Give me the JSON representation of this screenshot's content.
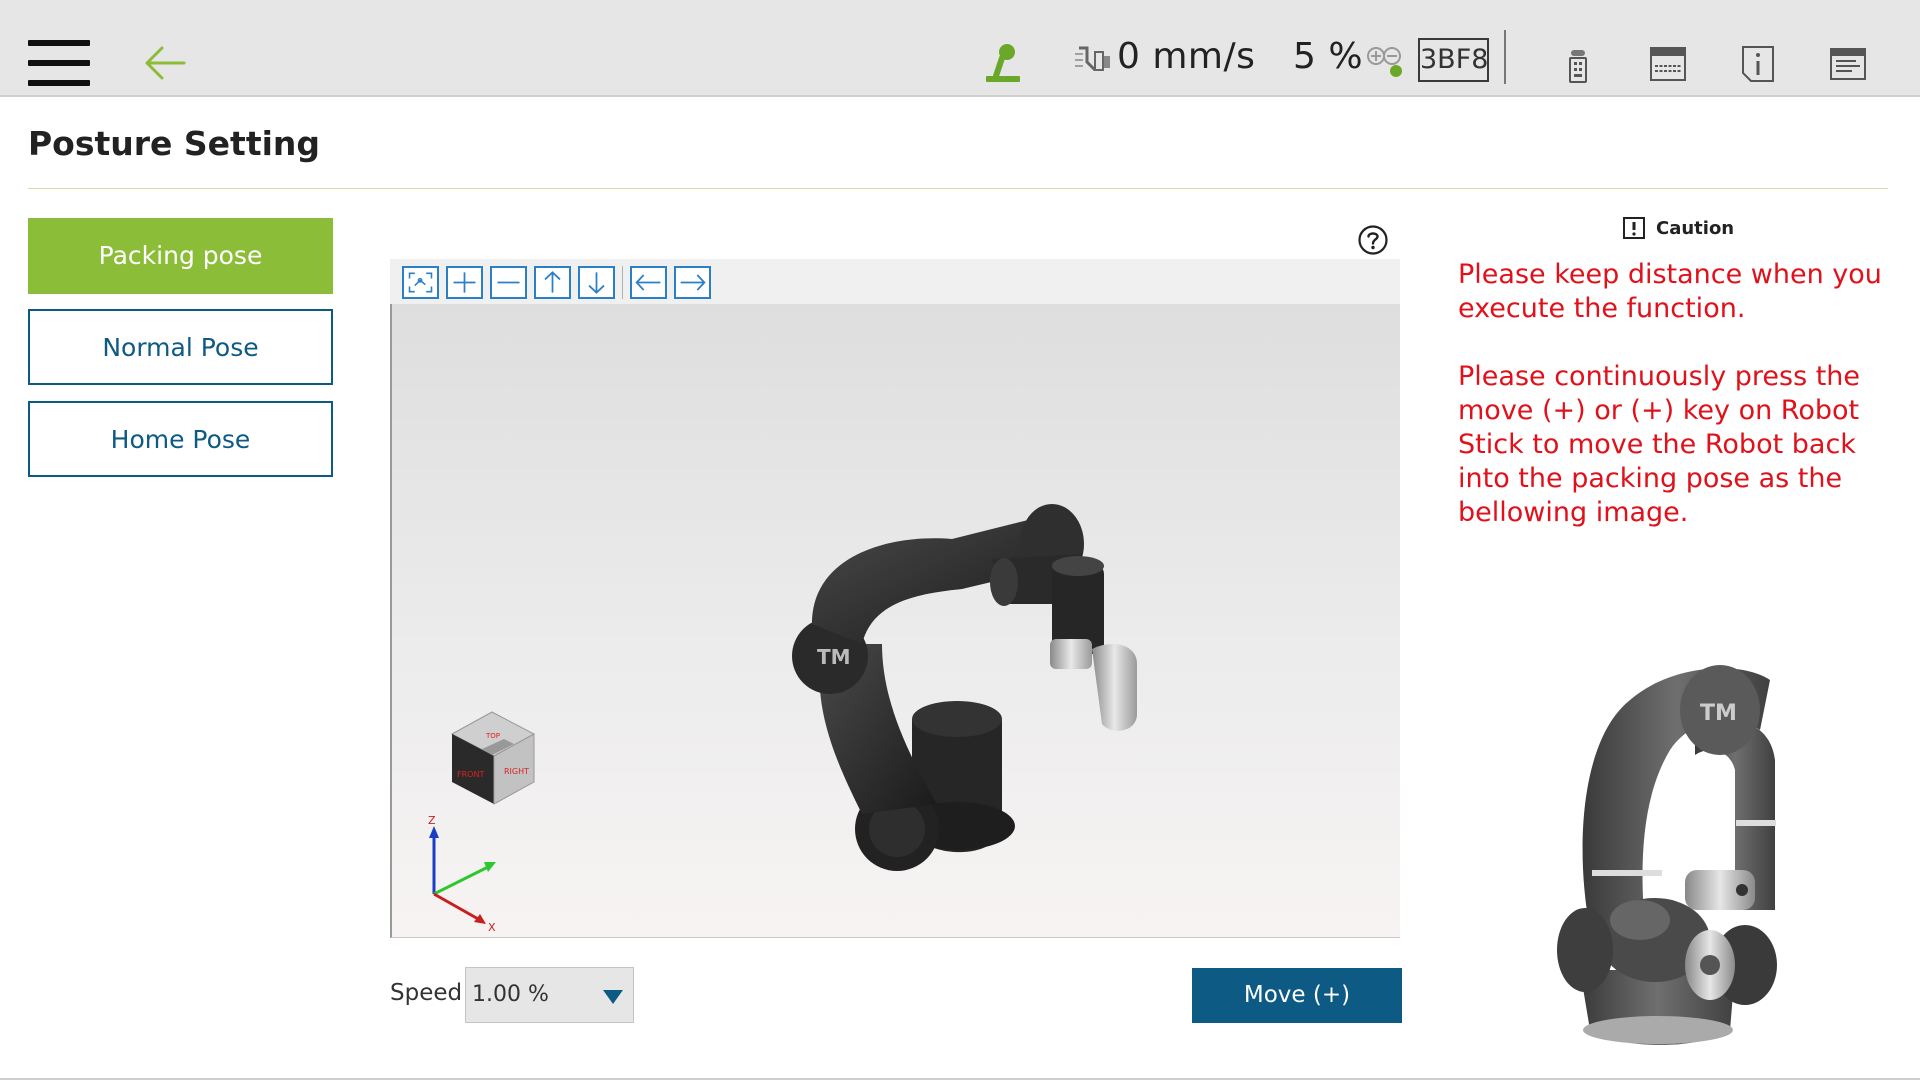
{
  "topbar": {
    "speed": "0 mm/s",
    "speed_percent": "5 %",
    "robot_id": "3BF8"
  },
  "page": {
    "title": "Posture Setting"
  },
  "poses": [
    {
      "label": "Packing pose",
      "active": true
    },
    {
      "label": "Normal Pose",
      "active": false
    },
    {
      "label": "Home Pose",
      "active": false
    }
  ],
  "viewer": {
    "toolbar": [
      "fit-view-icon",
      "zoom-in-icon",
      "zoom-out-icon",
      "arrow-up-icon",
      "arrow-down-icon",
      "arrow-left-icon",
      "arrow-right-icon"
    ],
    "axes": {
      "z": "Z",
      "x": "X"
    },
    "cube_faces": {
      "front": "FRONT",
      "right": "RIGHT",
      "top": "TOP"
    }
  },
  "controls": {
    "speed_label": "Speed",
    "speed_value": "1.00 %",
    "move_label": "Move (+)"
  },
  "caution": {
    "title": "Caution",
    "paragraph1": "Please keep distance when you execute the function.",
    "paragraph2": "Please continuously press the move (+) or (+) key on Robot Stick to move the Robot back into the packing  pose as the bellowing image."
  },
  "colors": {
    "accent_green": "#8cbd38",
    "primary_blue": "#0d5a85",
    "caution_red": "#e0111b",
    "toolbar_blue": "#2b7fc6"
  }
}
